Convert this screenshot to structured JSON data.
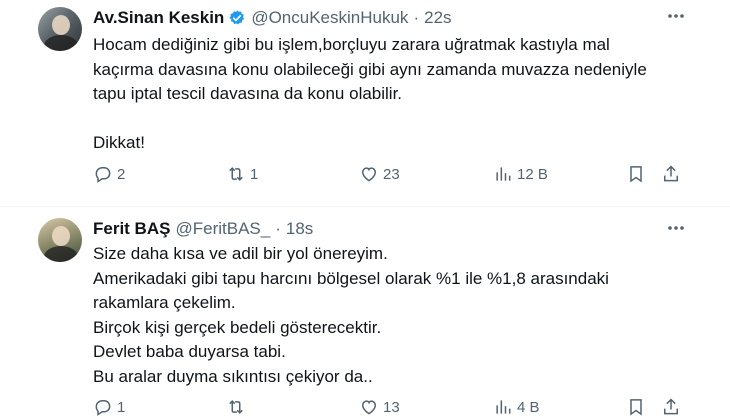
{
  "tweets": [
    {
      "author_name": "Av.Sinan Keskin",
      "handle": "@OncuKeskinHukuk",
      "separator": "·",
      "time": "22s",
      "verified": true,
      "lines": [
        "Hocam dediğiniz gibi bu işlem,borçluyu zarara uğratmak kastıyla mal",
        "kaçırma davasına konu olabileceği gibi aynı zamanda muvazza nedeniyle",
        "tapu iptal tescil davasına da konu olabilir.",
        "",
        "Dikkat!"
      ],
      "replies": "2",
      "retweets": "1",
      "likes": "23",
      "views": "12 B"
    },
    {
      "author_name": "Ferit BAŞ",
      "handle": "@FeritBAS_",
      "separator": "·",
      "time": "18s",
      "verified": false,
      "lines": [
        "Size daha kısa ve adil bir yol önereyim.",
        "Amerikadaki gibi tapu harcını bölgesel olarak %1 ile %1,8 arasındaki",
        "rakamlara çekelim.",
        "Birçok kişi gerçek bedeli gösterecektir.",
        "Devlet baba duyarsa tabi.",
        "Bu aralar duyma sıkıntısı çekiyor da.."
      ],
      "replies": "1",
      "retweets": "",
      "likes": "13",
      "views": "4 B"
    }
  ],
  "colors": {
    "text": "#0f1419",
    "secondary": "#536471",
    "verified_badge": "#1d9bf0",
    "divider": "#eff3f4"
  },
  "icons": [
    "more-icon",
    "verified-badge-icon",
    "reply-icon",
    "retweet-icon",
    "like-icon",
    "views-icon",
    "bookmark-icon",
    "share-icon"
  ]
}
